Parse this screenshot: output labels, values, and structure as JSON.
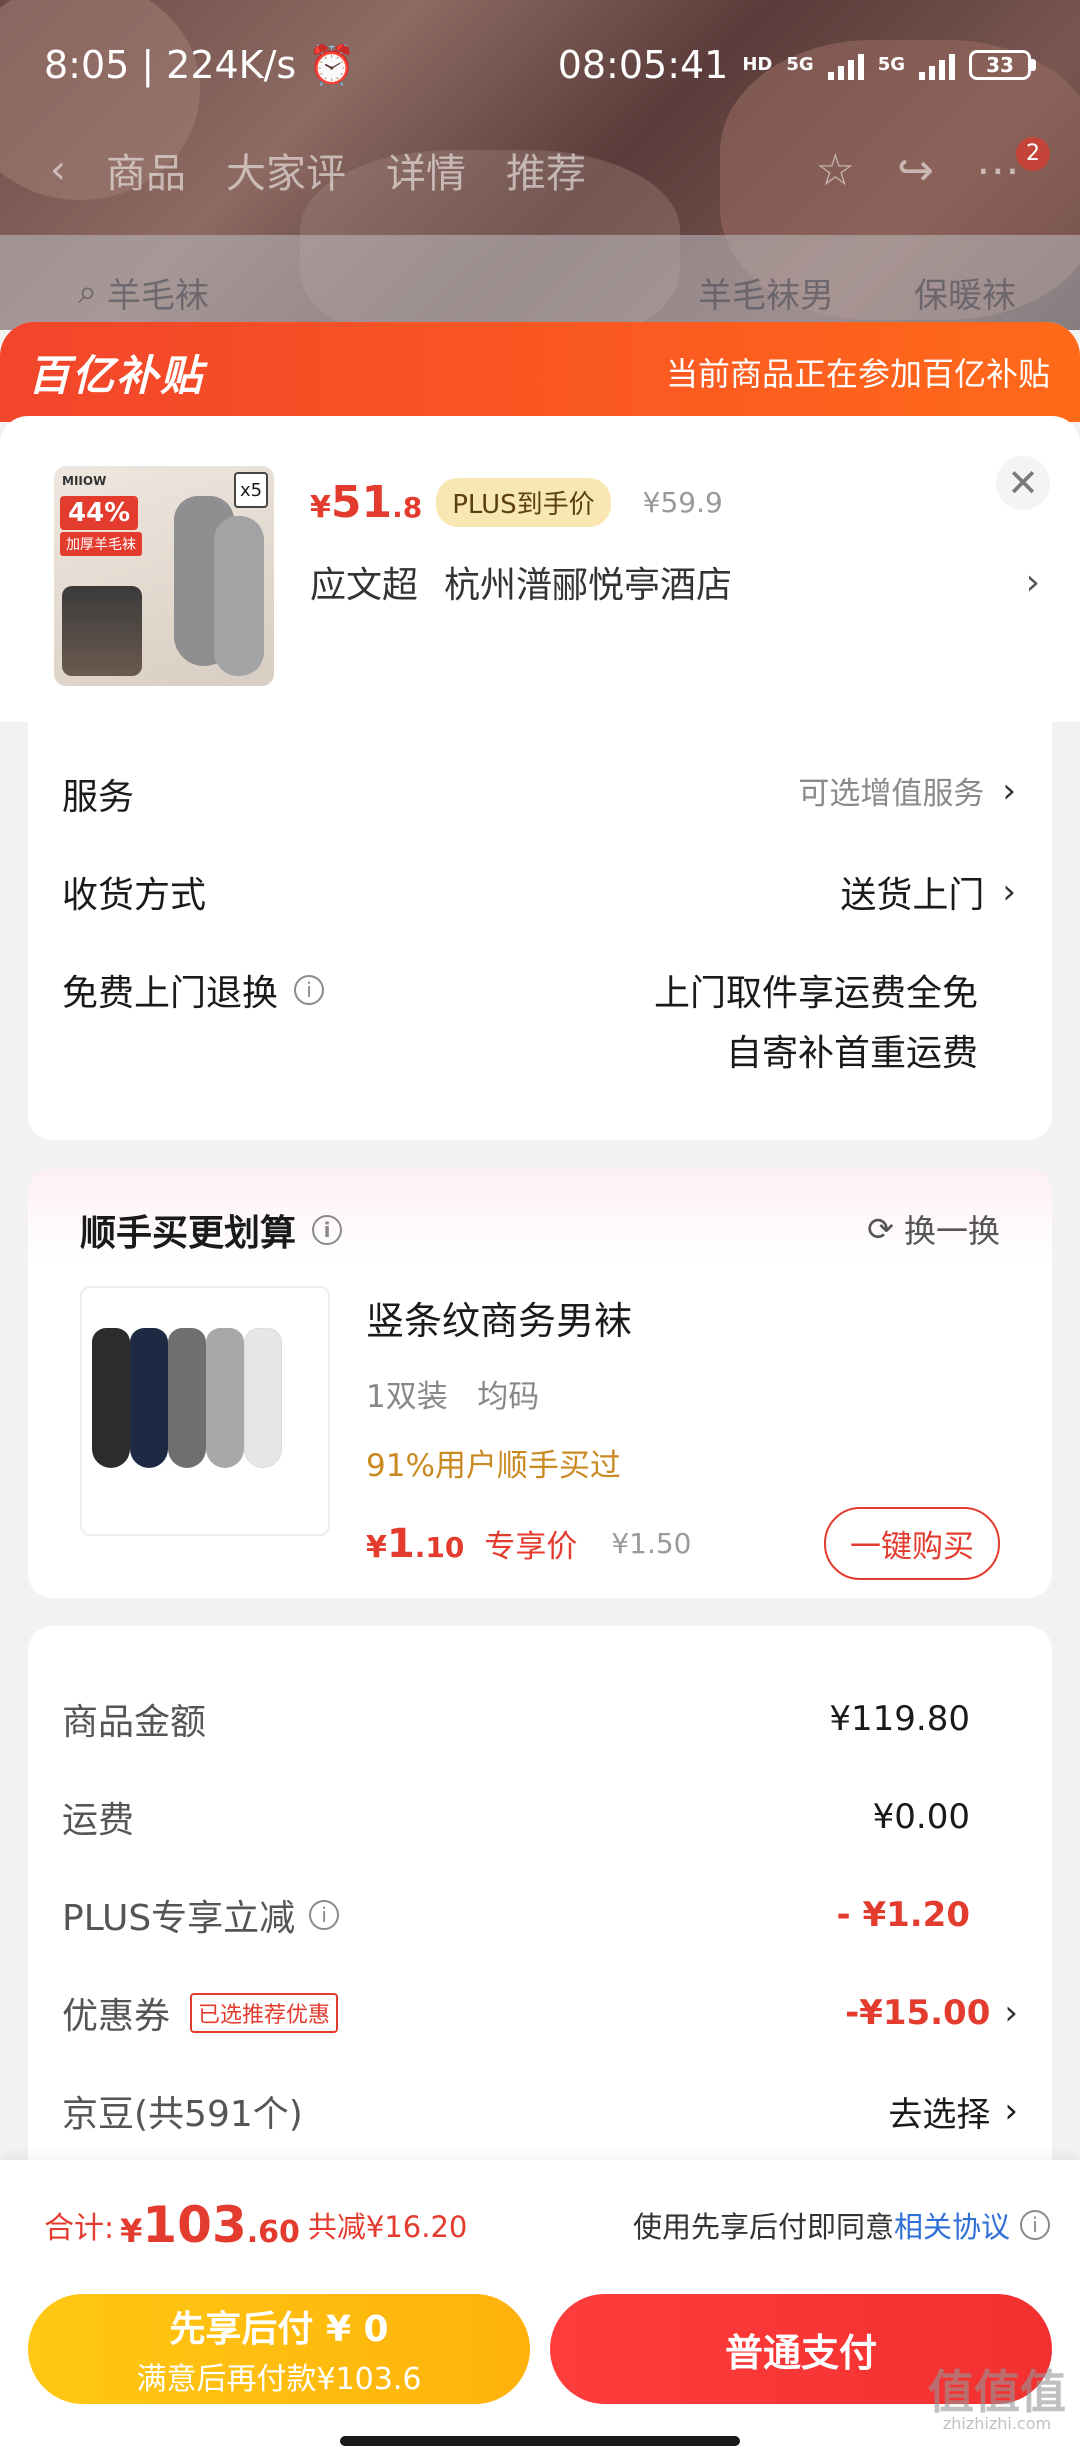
{
  "status_bar": {
    "time": "8:05",
    "speed": "224K/s",
    "clock": "08:05:41",
    "net1": "5G",
    "net2": "5G",
    "battery": "33",
    "hd": "HD"
  },
  "top_nav": {
    "tabs": [
      "商品",
      "大家评",
      "详情",
      "推荐"
    ],
    "badge": "2"
  },
  "dim_search": {
    "query": "羊毛袜",
    "tag1": "羊毛袜男",
    "tag2": "保暖袜"
  },
  "subsidy": {
    "logo": "百亿补贴",
    "text": "当前商品正在参加百亿补贴"
  },
  "product": {
    "price_sym": "¥",
    "price_int": "51",
    "price_dec": ".8",
    "plus_tag": "PLUS到手价",
    "old_price": "¥59.9",
    "address_name": "应文超",
    "address": "杭州潽郦悦亭酒店",
    "thumb_tag": "44%",
    "thumb_sub": "加厚羊毛袜",
    "thumb_qty": "x5",
    "thumb_brand": "MIIOW"
  },
  "services": [
    {
      "label": "服务",
      "value": "可选增值服务"
    },
    {
      "label": "收货方式",
      "value": "送货上门"
    },
    {
      "label": "免费上门退换",
      "value_line1": "上门取件享运费全免",
      "value_line2": "自寄补首重运费"
    }
  ],
  "recommend": {
    "title": "顺手买更划算",
    "swap": "换一换",
    "item_title": "竖条纹商务男袜",
    "spec1": "1双装",
    "spec2": "均码",
    "bought": "91%用户顺手买过",
    "price_sym": "¥",
    "price_int": "1",
    "price_dec": ".10",
    "excl": "专享价",
    "old": "¥1.50",
    "buy": "一键购买"
  },
  "amounts": [
    {
      "label": "商品金额",
      "value": "¥119.80"
    },
    {
      "label": "运费",
      "value": "¥0.00"
    },
    {
      "label": "PLUS专享立减",
      "value": "- ¥1.20"
    },
    {
      "label": "优惠券",
      "tag": "已选推荐优惠",
      "value": "-¥15.00"
    },
    {
      "label": "京豆(共591个)",
      "value": "去选择"
    }
  ],
  "footer": {
    "total_label": "合计:",
    "total_sym": "¥",
    "total_int": "103",
    "total_dec": ".60",
    "total_off": "共减¥16.20",
    "agree_text": "使用先享后付即同意",
    "agree_link": "相关协议",
    "later_line1": "先享后付 ¥ 0",
    "later_line2": "满意后再付款¥103.6",
    "pay": "普通支付"
  },
  "watermark": {
    "text": "值值值",
    "sub": "zhizhizhi.com"
  },
  "colors": {
    "accent": "#e33b2e",
    "subsidy": "#f2452c",
    "later": "#ffc814",
    "link": "#2f6fd6"
  }
}
